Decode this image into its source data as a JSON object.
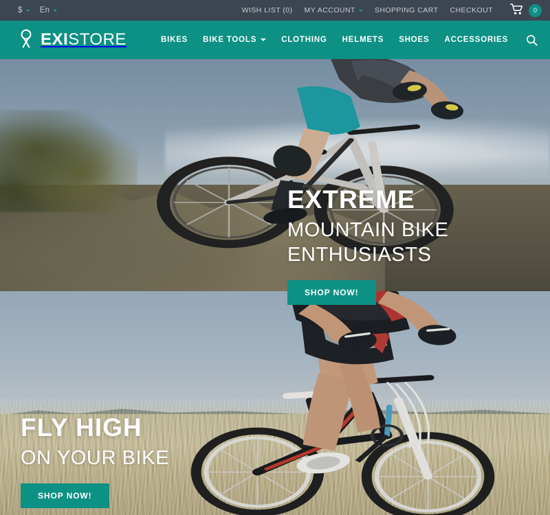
{
  "topbar": {
    "currency": {
      "label": "$",
      "icon": "chevron-down-icon"
    },
    "language": {
      "label": "En",
      "icon": "chevron-down-icon"
    },
    "links": [
      {
        "label": "WISH LIST (0)",
        "name": "wish-list"
      },
      {
        "label": "MY ACCOUNT",
        "name": "my-account",
        "caret": true
      },
      {
        "label": "SHOPPING CART",
        "name": "shopping-cart"
      },
      {
        "label": "CHECKOUT",
        "name": "checkout"
      }
    ],
    "cart": {
      "icon": "shopping-cart-icon",
      "count": "0"
    }
  },
  "header": {
    "logo": {
      "icon": "existore-logo-icon",
      "bold": "EXI",
      "light": "STORE"
    },
    "nav": [
      {
        "label": "BIKES",
        "name": "bikes",
        "caret": false
      },
      {
        "label": "BIKE TOOLS",
        "name": "bike-tools",
        "caret": true
      },
      {
        "label": "CLOTHING",
        "name": "clothing",
        "caret": false
      },
      {
        "label": "HELMETS",
        "name": "helmets",
        "caret": false
      },
      {
        "label": "SHOES",
        "name": "shoes",
        "caret": false
      },
      {
        "label": "ACCESSORIES",
        "name": "accessories",
        "caret": false
      }
    ],
    "search": {
      "icon": "search-icon"
    }
  },
  "slider": {
    "slides": [
      {
        "title": "EXTREME",
        "subtitle": "MOUNTAIN BIKE ENTHUSIASTS",
        "button": "SHOP NOW!",
        "scene": "mountain-biker-on-rocky-ridge"
      },
      {
        "title": "FLY HIGH",
        "subtitle": "ON YOUR BIKE",
        "button": "SHOP NOW!",
        "scene": "cyclist-in-wheat-field"
      }
    ]
  },
  "colors": {
    "brand_teal": "#0c9184",
    "button_teal": "#0d9184",
    "topbar_dark": "#3d4550",
    "text_light": "#c8ced5",
    "white": "#ffffff"
  }
}
